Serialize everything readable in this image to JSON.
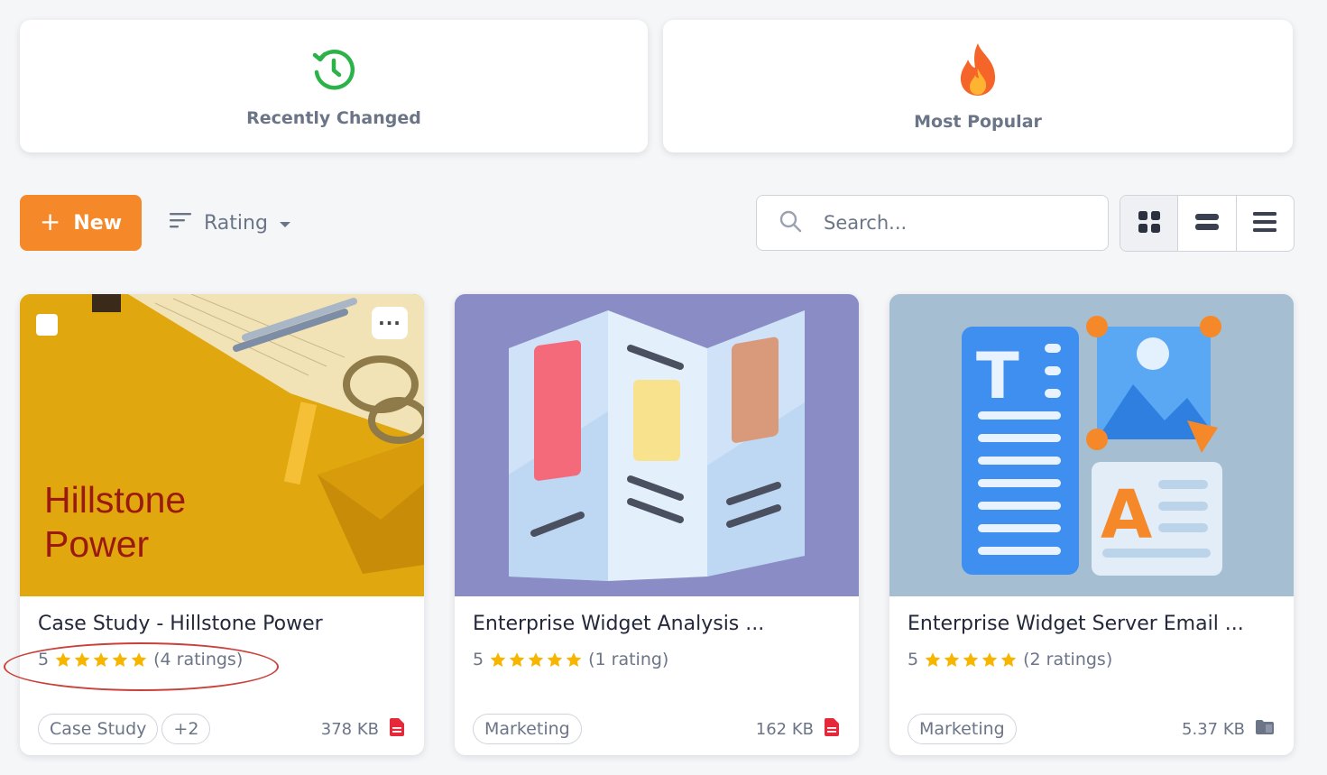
{
  "filters": {
    "recent": {
      "label": "Recently Changed",
      "icon": "clock-refresh-icon",
      "color": "#2bb34a"
    },
    "popular": {
      "label": "Most Popular",
      "icon": "fire-icon",
      "color": "#f5652a"
    }
  },
  "toolbar": {
    "new_label": "New",
    "sort_label": "Rating",
    "search_placeholder": "Search...",
    "views": [
      "grid-view",
      "card-view",
      "list-view"
    ],
    "active_view": "grid-view"
  },
  "accent_color": "#f5892a",
  "assets": [
    {
      "title": "Case Study - Hillstone Power",
      "thumb_text_line1": "Hillstone",
      "thumb_text_line2": "Power",
      "rating": "5",
      "stars": 5,
      "rating_count": "(4 ratings)",
      "tags": [
        "Case Study",
        "+2"
      ],
      "size": "378 KB",
      "file_type": "pdf-file-icon"
    },
    {
      "title": "Enterprise Widget Analysis ...",
      "rating": "5",
      "stars": 5,
      "rating_count": "(1 rating)",
      "tags": [
        "Marketing"
      ],
      "size": "162 KB",
      "file_type": "pdf-file-icon"
    },
    {
      "title": "Enterprise Widget Server Email ...",
      "rating": "5",
      "stars": 5,
      "rating_count": "(2 ratings)",
      "tags": [
        "Marketing"
      ],
      "size": "5.37 KB",
      "file_type": "folder-icon"
    }
  ]
}
